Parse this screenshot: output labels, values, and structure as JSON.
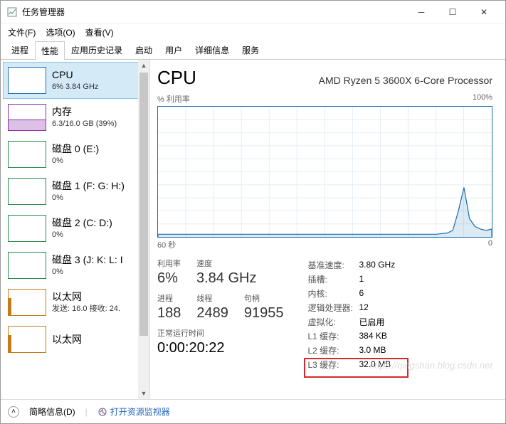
{
  "window": {
    "title": "任务管理器"
  },
  "menu": {
    "file": "文件(F)",
    "options": "选项(O)",
    "view": "查看(V)"
  },
  "tabs": [
    "进程",
    "性能",
    "应用历史记录",
    "启动",
    "用户",
    "详细信息",
    "服务"
  ],
  "activeTab": 1,
  "sidebar": [
    {
      "title": "CPU",
      "sub": "6% 3.84 GHz",
      "thumb": "cpu",
      "selected": true
    },
    {
      "title": "内存",
      "sub": "6.3/16.0 GB (39%)",
      "thumb": "mem"
    },
    {
      "title": "磁盘 0 (E:)",
      "sub": "0%",
      "thumb": "disk"
    },
    {
      "title": "磁盘 1 (F: G: H:)",
      "sub": "0%",
      "thumb": "disk"
    },
    {
      "title": "磁盘 2 (C: D:)",
      "sub": "0%",
      "thumb": "disk"
    },
    {
      "title": "磁盘 3 (J: K: L: I",
      "sub": "0%",
      "thumb": "disk"
    },
    {
      "title": "以太网",
      "sub": "发送: 16.0  接收: 24.",
      "thumb": "net"
    },
    {
      "title": "以太网",
      "sub": "",
      "thumb": "net"
    }
  ],
  "header": {
    "title": "CPU",
    "name": "AMD Ryzen 5 3600X 6-Core Processor"
  },
  "chart": {
    "yLabel": "% 利用率",
    "yMax": "100%",
    "xLeft": "60 秒",
    "xRight": "0"
  },
  "leftStats": {
    "row1": [
      {
        "lbl": "利用率",
        "val": "6%"
      },
      {
        "lbl": "速度",
        "val": "3.84 GHz"
      }
    ],
    "row2": [
      {
        "lbl": "进程",
        "val": "188"
      },
      {
        "lbl": "线程",
        "val": "2489"
      },
      {
        "lbl": "句柄",
        "val": "91955"
      }
    ],
    "uptime": {
      "lbl": "正常运行时间",
      "val": "0:00:20:22"
    }
  },
  "rightStats": [
    {
      "k": "基准速度:",
      "v": "3.80 GHz"
    },
    {
      "k": "插槽:",
      "v": "1"
    },
    {
      "k": "内核:",
      "v": "6"
    },
    {
      "k": "逻辑处理器:",
      "v": "12"
    },
    {
      "k": "虚拟化:",
      "v": "已启用"
    },
    {
      "k": "L1 缓存:",
      "v": "384 KB"
    },
    {
      "k": "L2 缓存:",
      "v": "3.0 MB"
    },
    {
      "k": "L3 缓存:",
      "v": "32.0 MB"
    }
  ],
  "statusbar": {
    "less": "简略信息(D)",
    "resmon": "打开资源监视器"
  },
  "watermark": "https://qingshan.blog.csdn.net",
  "chart_data": {
    "type": "line",
    "title": "% 利用率",
    "xlabel": "秒",
    "ylabel": "% 利用率",
    "ylim": [
      0,
      100
    ],
    "xlim": [
      60,
      0
    ],
    "x": [
      60,
      55,
      50,
      45,
      40,
      35,
      30,
      25,
      20,
      15,
      10,
      8,
      7,
      6,
      5,
      4,
      3,
      2,
      1,
      0
    ],
    "values": [
      2,
      2,
      2,
      2,
      2,
      2,
      2,
      2,
      2,
      2,
      2,
      3,
      5,
      20,
      38,
      14,
      8,
      6,
      5,
      6
    ]
  }
}
